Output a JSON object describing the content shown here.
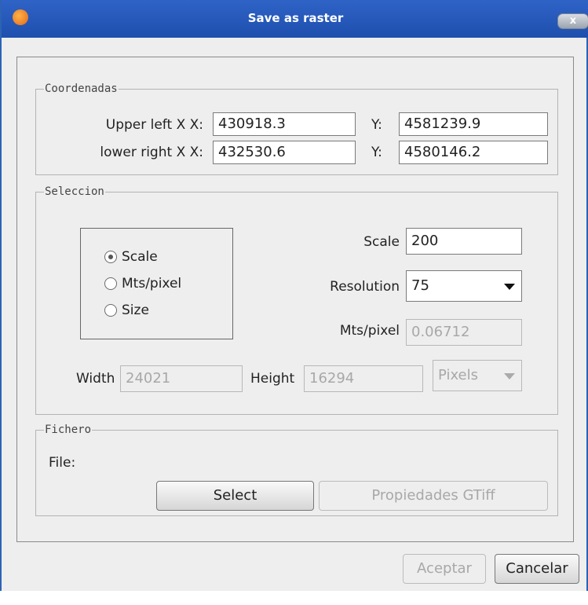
{
  "window": {
    "title": "Save as raster",
    "close_label": "x"
  },
  "coordenadas": {
    "legend": "Coordenadas",
    "upper_left_label": "Upper left X",
    "x_label": "X:",
    "y_label": "Y:",
    "upper_left_x": "430918.3",
    "upper_left_y": "4581239.9",
    "lower_right_label": "lower right X",
    "lower_right_x": "432530.6",
    "lower_right_y": "4580146.2"
  },
  "seleccion": {
    "legend": "Seleccion",
    "radio_options": [
      {
        "label": "Scale",
        "checked": true
      },
      {
        "label": "Mts/pixel",
        "checked": false
      },
      {
        "label": "Size",
        "checked": false
      }
    ],
    "scale_label": "Scale",
    "scale_value": "200",
    "resolution_label": "Resolution",
    "resolution_value": "75",
    "mts_pixel_label": "Mts/pixel",
    "mts_pixel_value": "0.06712",
    "width_label": "Width",
    "width_value": "24021",
    "height_label": "Height",
    "height_value": "16294",
    "unit_value": "Pixels"
  },
  "fichero": {
    "legend": "Fichero",
    "file_label": "File:",
    "select_label": "Select",
    "gtiff_label": "Propiedades GTiff"
  },
  "footer": {
    "accept_label": "Aceptar",
    "cancel_label": "Cancelar"
  }
}
